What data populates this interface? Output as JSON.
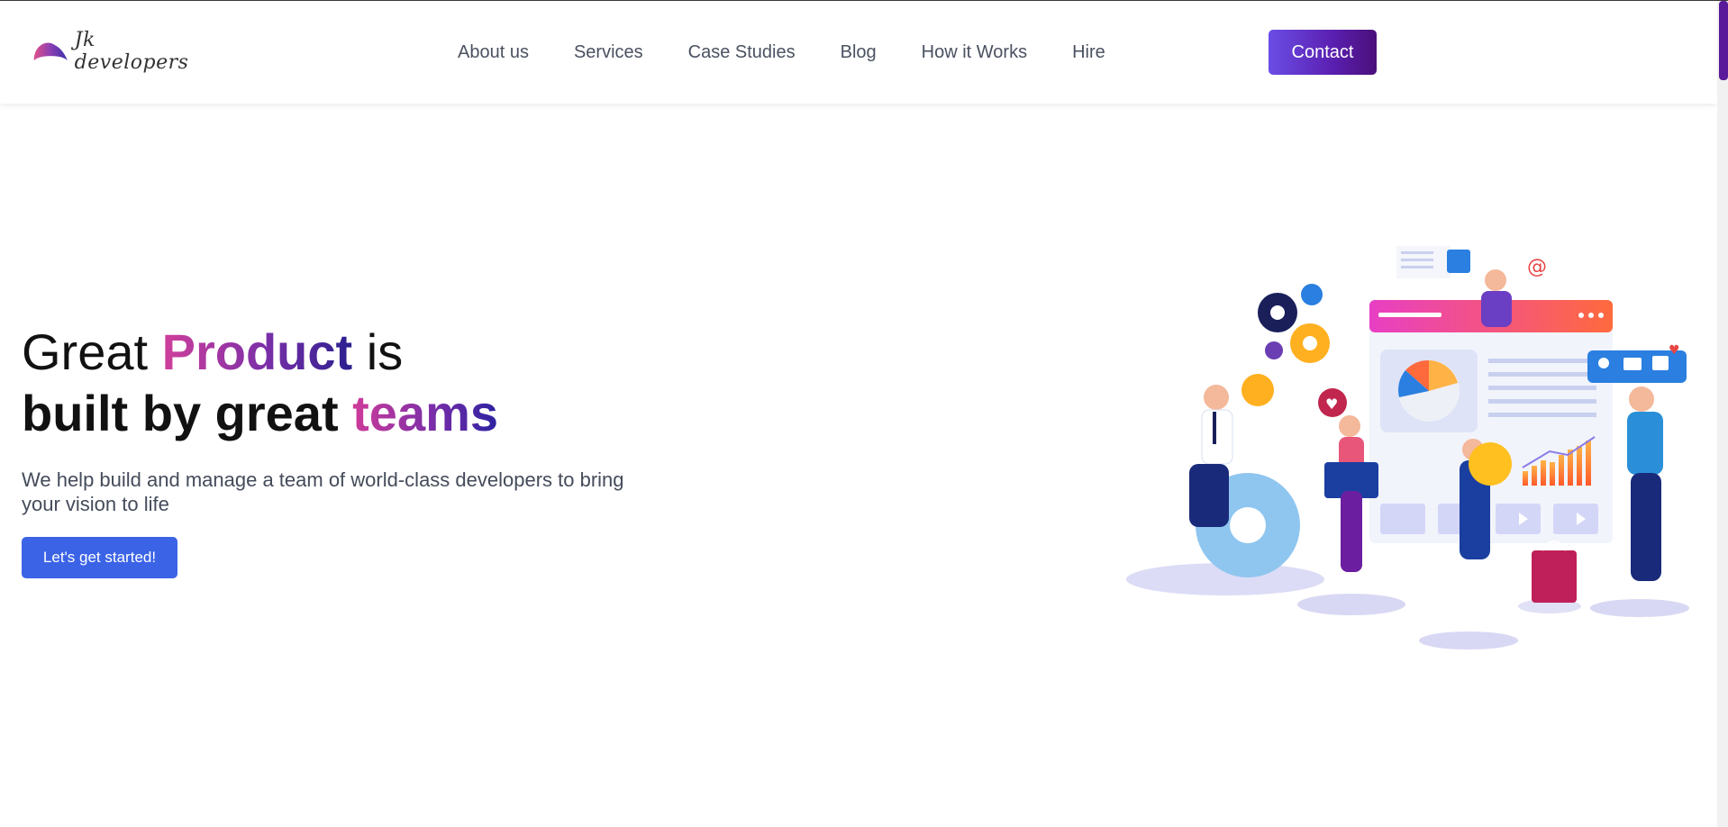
{
  "header": {
    "logo_text": "Jk developers",
    "nav": [
      {
        "label": "About us"
      },
      {
        "label": "Services"
      },
      {
        "label": "Case Studies"
      },
      {
        "label": "Blog"
      },
      {
        "label": "How it Works"
      },
      {
        "label": "Hire"
      }
    ],
    "contact_label": "Contact"
  },
  "hero": {
    "line1_part1": "Great ",
    "line1_highlight": "Product",
    "line1_part2": " is",
    "line2_part1": "built by great ",
    "line2_highlight": "teams",
    "subtitle": "We help build and manage a team of world-class developers to bring your vision to life",
    "cta_label": "Let's get started!"
  },
  "colors": {
    "accent_blue": "#3b63e6",
    "contact_gradient_start": "#6b4de6",
    "contact_gradient_end": "#4a0f7a",
    "headline_gradient_pink": "#d03f9b",
    "headline_gradient_navy": "#2a1f8f"
  },
  "illustration": {
    "icons": [
      "cart-icon",
      "at-sign-icon",
      "gear-icon",
      "heart-icon",
      "user-icon",
      "chat-icon",
      "thumbs-up-icon",
      "lightbulb-icon",
      "play-icon",
      "shopping-bag-icon",
      "pie-chart-icon",
      "bar-chart-icon"
    ]
  }
}
